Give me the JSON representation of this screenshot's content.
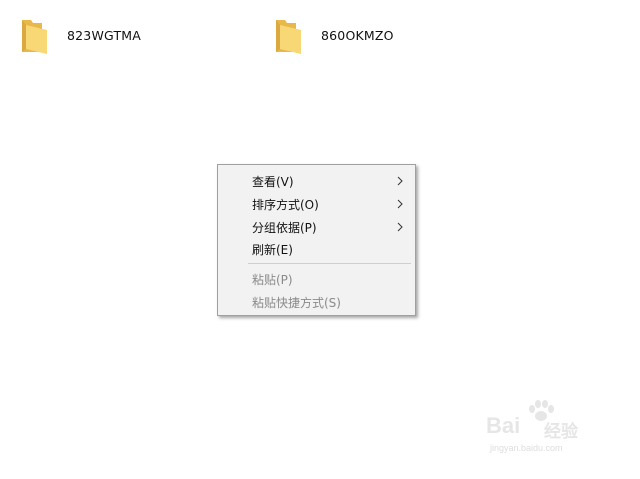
{
  "desktop": {
    "folders": [
      {
        "name": "823WGTMA",
        "icon": "folder-icon"
      },
      {
        "name": "860OKMZO",
        "icon": "folder-icon"
      }
    ]
  },
  "context_menu": {
    "items": [
      {
        "label": "查看(V)",
        "has_submenu": true,
        "enabled": true
      },
      {
        "label": "排序方式(O)",
        "has_submenu": true,
        "enabled": true
      },
      {
        "label": "分组依据(P)",
        "has_submenu": true,
        "enabled": true
      },
      {
        "label": "刷新(E)",
        "has_submenu": false,
        "enabled": true
      },
      {
        "label": "粘贴(P)",
        "has_submenu": false,
        "enabled": false
      },
      {
        "label": "粘贴快捷方式(S)",
        "has_submenu": false,
        "enabled": false
      }
    ]
  },
  "watermark": {
    "brand": "Bai",
    "brand_suffix": "经验",
    "url": "jingyan.baidu.com"
  },
  "colors": {
    "folder_yellow": "#f8d775",
    "folder_back": "#e8b84a",
    "menu_bg": "#f2f2f2",
    "menu_border": "#a0a0a0",
    "disabled_text": "#8a8a8a"
  }
}
